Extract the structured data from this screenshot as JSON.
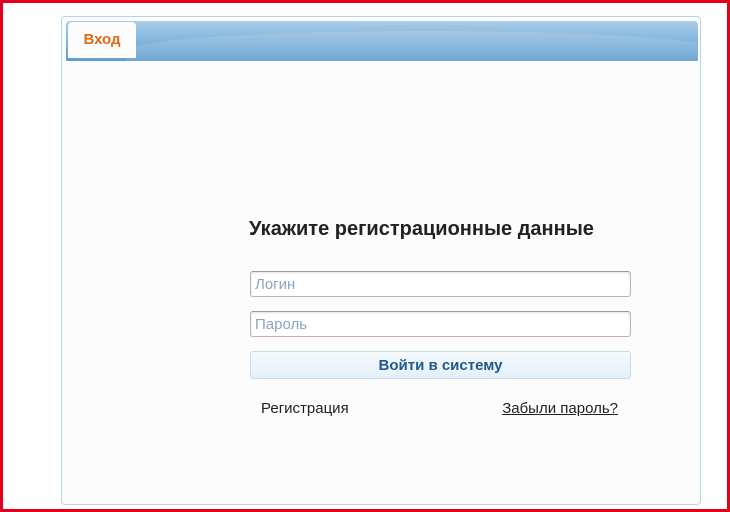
{
  "tabs": [
    {
      "label": "Вход",
      "active": true
    }
  ],
  "login_form": {
    "title": "Укажите регистрационные данные",
    "login_placeholder": "Логин",
    "password_placeholder": "Пароль",
    "submit_label": "Войти в систему",
    "register_label": "Регистрация",
    "forgot_label": "Забыли пароль?"
  },
  "colors": {
    "frame_border": "#e3001b",
    "tab_accent": "#e06a16",
    "button_text": "#1f5a8c",
    "tabbar_blue": "#7fb2da"
  }
}
